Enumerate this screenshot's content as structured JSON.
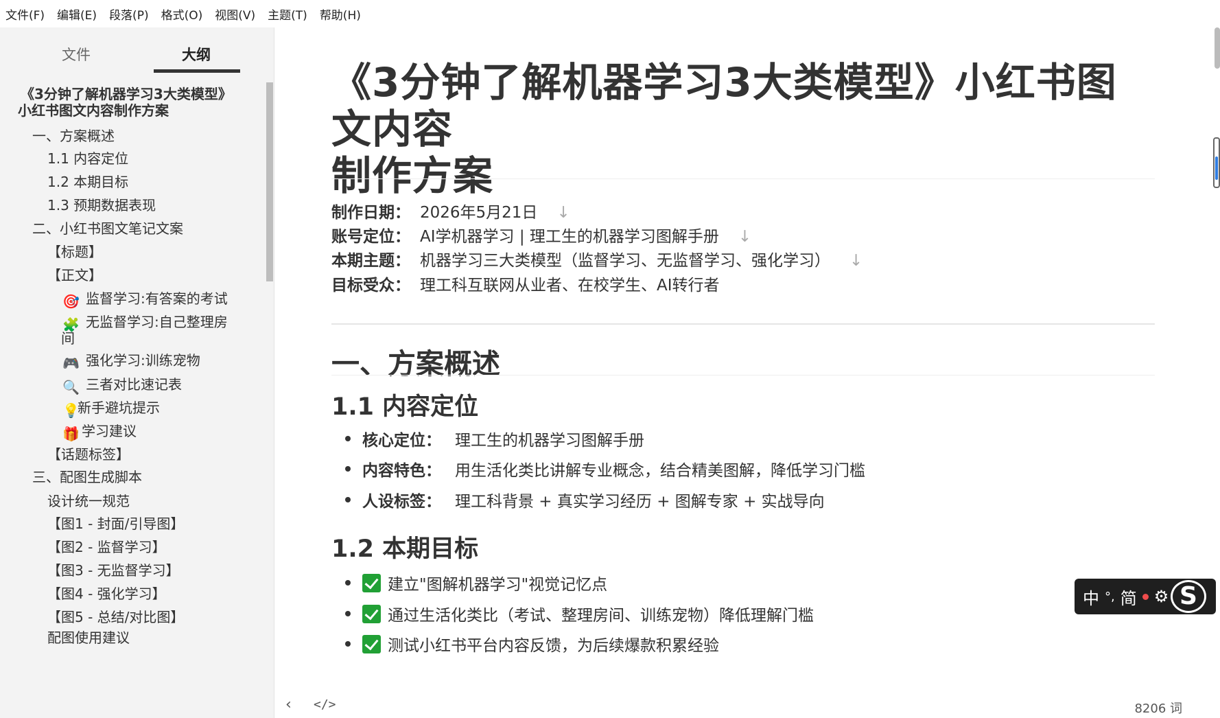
{
  "menu": [
    "文件(F)",
    "编辑(E)",
    "段落(P)",
    "格式(O)",
    "视图(V)",
    "主题(T)",
    "帮助(H)"
  ],
  "sidebar": {
    "tabs": [
      "文件",
      "大纲"
    ],
    "active_tab": "大纲",
    "outline": [
      {
        "label": "《3分钟了解机器学习3大类模型》",
        "bold": true
      },
      {
        "label": "小红书图文内容制作方案",
        "bold": true
      },
      {
        "label": "一、方案概述"
      },
      {
        "label": "1.1 内容定位"
      },
      {
        "label": "1.2 本期目标"
      },
      {
        "label": "1.3 预期数据表现"
      },
      {
        "label": "二、小红书图文笔记文案"
      },
      {
        "label": "【标题】"
      },
      {
        "label": "【正文】"
      },
      {
        "label": "监督学习:有答案的考试",
        "icon": "🎯",
        "icon_name": "target-icon"
      },
      {
        "label": "无监督学习:自己整理房",
        "icon": "🧩",
        "icon_name": "puzzle-icon"
      },
      {
        "label": "间"
      },
      {
        "label": "强化学习:训练宠物",
        "icon": "🎮",
        "icon_name": "gamepad-icon"
      },
      {
        "label": "三者对比速记表",
        "icon": "🔍",
        "icon_name": "magnifier-icon"
      },
      {
        "label": "新手避坑提示",
        "icon": "💡",
        "icon_name": "lightbulb-icon"
      },
      {
        "label": "学习建议",
        "icon": "🎁",
        "icon_name": "gift-icon"
      },
      {
        "label": "【话题标签】"
      },
      {
        "label": "三、配图生成脚本"
      },
      {
        "label": "设计统一规范"
      },
      {
        "label": "【图1 - 封面/引导图】"
      },
      {
        "label": "【图2 - 监督学习】"
      },
      {
        "label": "【图3 - 无监督学习】"
      },
      {
        "label": "【图4 - 强化学习】"
      },
      {
        "label": "【图5 - 总结/对比图】"
      },
      {
        "label": "配图使用建议"
      }
    ]
  },
  "doc": {
    "title_line1": "《3分钟了解机器学习3大类模型》小红书图文内容",
    "title_line2": "制作方案",
    "meta": [
      {
        "key": "制作日期：",
        "value": "2026年5月21日",
        "arrow": "↓"
      },
      {
        "key": "账号定位：",
        "value": "AI学机器学习 | 理工生的机器学习图解手册",
        "arrow": "↓"
      },
      {
        "key": "本期主题：",
        "value": "机器学习三大类模型（监督学习、无监督学习、强化学习）",
        "arrow": "↓"
      },
      {
        "key": "目标受众：",
        "value": "理工科互联网从业者、在校学生、AI转行者",
        "arrow": ""
      }
    ],
    "h1": "一、方案概述",
    "h2_positioning": "1.1 内容定位",
    "positioning": [
      {
        "key": "核心定位：",
        "value": "理工生的机器学习图解手册"
      },
      {
        "key": "内容特色：",
        "value": "用生活化类比讲解专业概念，结合精美图解，降低学习门槛"
      },
      {
        "key": "人设标签：",
        "value": "理工科背景 + 真实学习经历 + 图解专家 + 实战导向"
      }
    ],
    "h2_goals": "1.2 本期目标",
    "goals": [
      "建立\"图解机器学习\"视觉记忆点",
      "通过生活化类比（考试、整理房间、训练宠物）降低理解门槛",
      "测试小红书平台内容反馈，为后续爆款积累经验"
    ]
  },
  "ime": {
    "lang": "中",
    "punct": "°,",
    "mode": "简",
    "logo": "S"
  },
  "status": {
    "nav_back": "‹",
    "source_toggle": "</>",
    "word_count": "8206 词"
  }
}
